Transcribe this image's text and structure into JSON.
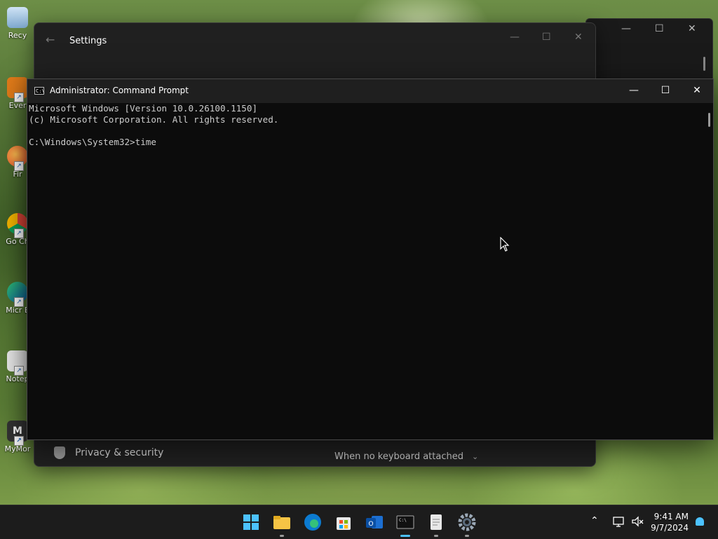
{
  "desktop": {
    "icons": [
      {
        "label": "Recy",
        "name": "recycle-bin"
      },
      {
        "label": "Ever",
        "name": "everything"
      },
      {
        "label": "Fir",
        "name": "firefox"
      },
      {
        "label": "Go Ch",
        "name": "google-chrome"
      },
      {
        "label": "Micr E",
        "name": "microsoft-edge"
      },
      {
        "label": "Notep",
        "name": "notepad"
      },
      {
        "label": "MyMor",
        "name": "mymor"
      }
    ]
  },
  "settings": {
    "title": "Settings",
    "footer_item": "Privacy & security",
    "dropdown_value": "When no keyboard attached"
  },
  "cmd": {
    "title": "Administrator: Command Prompt",
    "lines": [
      "Microsoft Windows [Version 10.0.26100.1150]",
      "(c) Microsoft Corporation. All rights reserved.",
      "",
      "C:\\Windows\\System32>time"
    ]
  },
  "taskbar": {
    "apps": [
      "start",
      "file-explorer",
      "edge",
      "microsoft-store",
      "outlook",
      "terminal",
      "notepad",
      "settings"
    ],
    "active_app": "terminal",
    "time": "9:41 AM",
    "date": "9/7/2024"
  },
  "colors": {
    "accent": "#4cc2ff",
    "cmd_bg": "#0c0c0c",
    "cmd_text": "#cccccc",
    "titlebar": "#1f1f1f"
  }
}
